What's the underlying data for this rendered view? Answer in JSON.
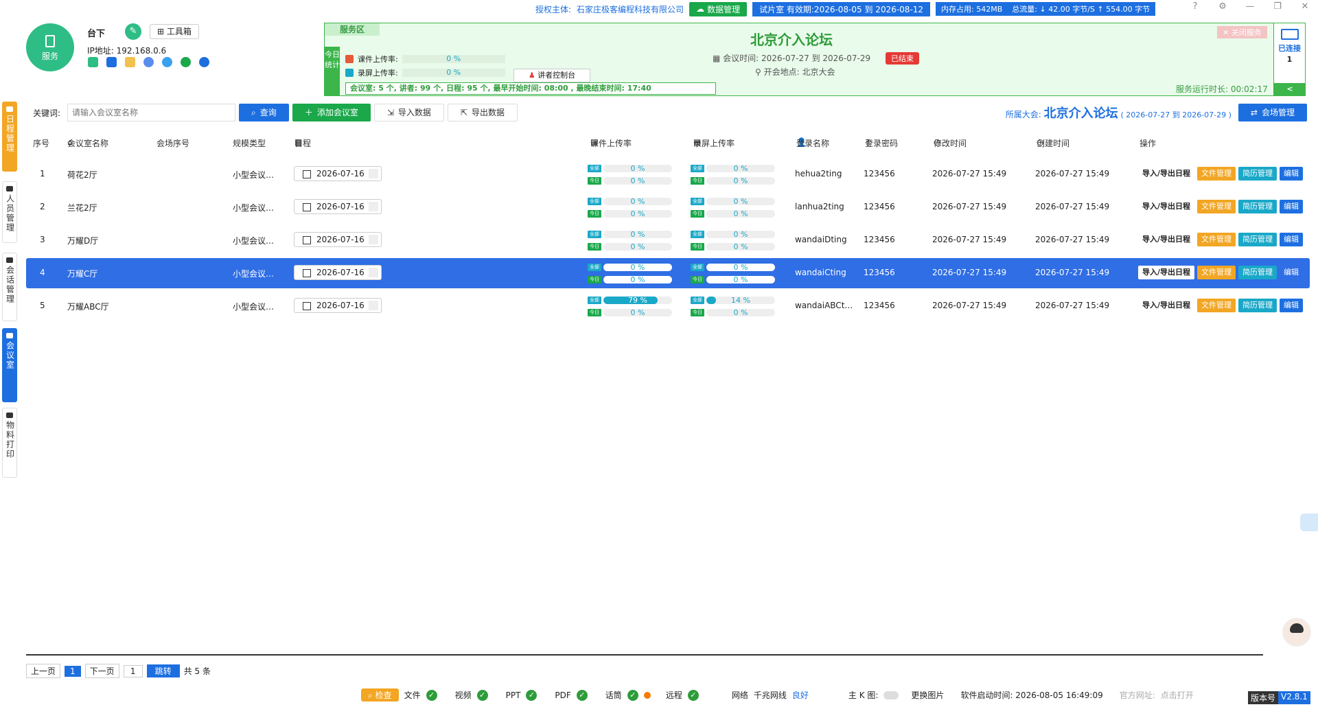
{
  "topbar": {
    "license_label": "授权主体:",
    "company": "石家庄极客编程科技有限公司",
    "data_mgmt": "数据管理",
    "trial": "试片室 有效期:2026-08-05 到 2026-08-12",
    "memory": "内存占用:  542MB",
    "traffic": "总流量:  ↓ 42.00 字节/S    ↑ 554.00 字节"
  },
  "profile": {
    "service_label": "服务",
    "role": "台下",
    "toolbox": "工具箱",
    "ip": "IP地址: 192.168.0.6"
  },
  "service_panel": {
    "tag": "服务区",
    "today_stats": "今日统计",
    "course_upload_label": "课件上传率:",
    "course_upload_value": "0 %",
    "screen_upload_label": "录屏上传率:",
    "screen_upload_value": "0 %",
    "console": "讲者控制台",
    "stats_line": "会议室:  5 个,  讲者:  99 个,  日程:  95 个,  最早开始时间:  08:00 ,   最晚结束时间:  17:40",
    "meeting_title": "北京介入论坛",
    "meeting_time": "会议时间:   2026-07-27   到   2026-07-29",
    "status": "已结束",
    "meeting_place": "开会地点:   北京大会",
    "close_service": "✕ 关闭服务",
    "runtime": "服务运行时长: 00:02:17",
    "conn_label": "已连接",
    "conn_count": "1",
    "collapse": "<"
  },
  "sidebar": {
    "tabs": [
      {
        "label": "日程管理"
      },
      {
        "label": "人员管理"
      },
      {
        "label": "会话管理"
      },
      {
        "label": "会议室"
      },
      {
        "label": "物料打印"
      }
    ]
  },
  "toolbar": {
    "keyword_label": "关键词:",
    "search_placeholder": "请输入会议室名称",
    "search_btn": "查询",
    "add_btn": "添加会议室",
    "import_btn": "导入数据",
    "export_btn": "导出数据",
    "conf_prefix": "所属大会:",
    "conf_name": "北京介入论坛",
    "conf_range": "( 2026-07-27 到 2026-07-29 )",
    "venue_btn": "会场管理"
  },
  "table": {
    "headers": [
      "序号",
      "会议室名称",
      "会场序号",
      "规模类型",
      "日程",
      "课件上传率",
      "录屏上传率",
      "登录名称",
      "登录密码",
      "修改时间",
      "创建时间",
      "操作"
    ],
    "tag_all": "全部",
    "tag_today": "今日",
    "rows": [
      {
        "no": "1",
        "name": "荷花2厅",
        "venue_no": "",
        "scale": "小型会议…",
        "date": "2026-07-16",
        "course_all": "0 %",
        "course_all_pct": 0,
        "course_today": "0 %",
        "course_today_pct": 0,
        "screen_all": "0 %",
        "screen_all_pct": 0,
        "screen_today": "0 %",
        "screen_today_pct": 0,
        "login": "hehua2ting",
        "password": "123456",
        "modified": "2026-07-27 15:49",
        "created": "2026-07-27 15:49"
      },
      {
        "no": "2",
        "name": "兰花2厅",
        "venue_no": "",
        "scale": "小型会议…",
        "date": "2026-07-16",
        "course_all": "0 %",
        "course_all_pct": 0,
        "course_today": "0 %",
        "course_today_pct": 0,
        "screen_all": "0 %",
        "screen_all_pct": 0,
        "screen_today": "0 %",
        "screen_today_pct": 0,
        "login": "lanhua2ting",
        "password": "123456",
        "modified": "2026-07-27 15:49",
        "created": "2026-07-27 15:49"
      },
      {
        "no": "3",
        "name": "万耀D厅",
        "venue_no": "",
        "scale": "小型会议…",
        "date": "2026-07-16",
        "course_all": "0 %",
        "course_all_pct": 0,
        "course_today": "0 %",
        "course_today_pct": 0,
        "screen_all": "0 %",
        "screen_all_pct": 0,
        "screen_today": "0 %",
        "screen_today_pct": 0,
        "login": "wandaiDting",
        "password": "123456",
        "modified": "2026-07-27 15:49",
        "created": "2026-07-27 15:49"
      },
      {
        "no": "4",
        "name": "万耀C厅",
        "venue_no": "",
        "scale": "小型会议…",
        "date": "2026-07-16",
        "course_all": "0 %",
        "course_all_pct": 0,
        "course_today": "0 %",
        "course_today_pct": 0,
        "screen_all": "0 %",
        "screen_all_pct": 0,
        "screen_today": "0 %",
        "screen_today_pct": 0,
        "login": "wandaiCting",
        "password": "123456",
        "modified": "2026-07-27 15:49",
        "created": "2026-07-27 15:49"
      },
      {
        "no": "5",
        "name": "万耀ABC厅",
        "venue_no": "",
        "scale": "小型会议…",
        "date": "2026-07-16",
        "course_all": "79 %",
        "course_all_pct": 79,
        "course_today": "0 %",
        "course_today_pct": 0,
        "screen_all": "14 %",
        "screen_all_pct": 14,
        "screen_today": "0 %",
        "screen_today_pct": 0,
        "login": "wandaiABCt…",
        "password": "123456",
        "modified": "2026-07-27 15:49",
        "created": "2026-07-27 15:49"
      }
    ],
    "selected_row": 4,
    "ops": {
      "schedule": "导入/导出日程",
      "files": "文件管理",
      "cv": "简历管理",
      "edit": "编辑"
    }
  },
  "pager": {
    "prev": "上一页",
    "current": "1",
    "next": "下一页",
    "input": "1",
    "go": "跳转",
    "total": "共 5 条"
  },
  "status_bar": {
    "check": "检查",
    "file": "文件",
    "video": "视频",
    "ppt": "PPT",
    "pdf": "PDF",
    "mic": "话筒",
    "remote": "远程",
    "net_label": "网络",
    "net_type": "千兆网线",
    "net_state": "良好",
    "main_k": "主 K 图:",
    "change_img": "更换图片",
    "start_time": "软件启动时间:  2026-08-05 16:49:09",
    "site_label": "官方网址:",
    "site_open": "点击打开",
    "version_label": "版本号",
    "version": "V2.8.1"
  },
  "colors": {
    "brand_blue": "#1d6fe0",
    "brand_green": "#2ebd85",
    "accent_orange": "#f2a624",
    "ended_red": "#e53935"
  }
}
